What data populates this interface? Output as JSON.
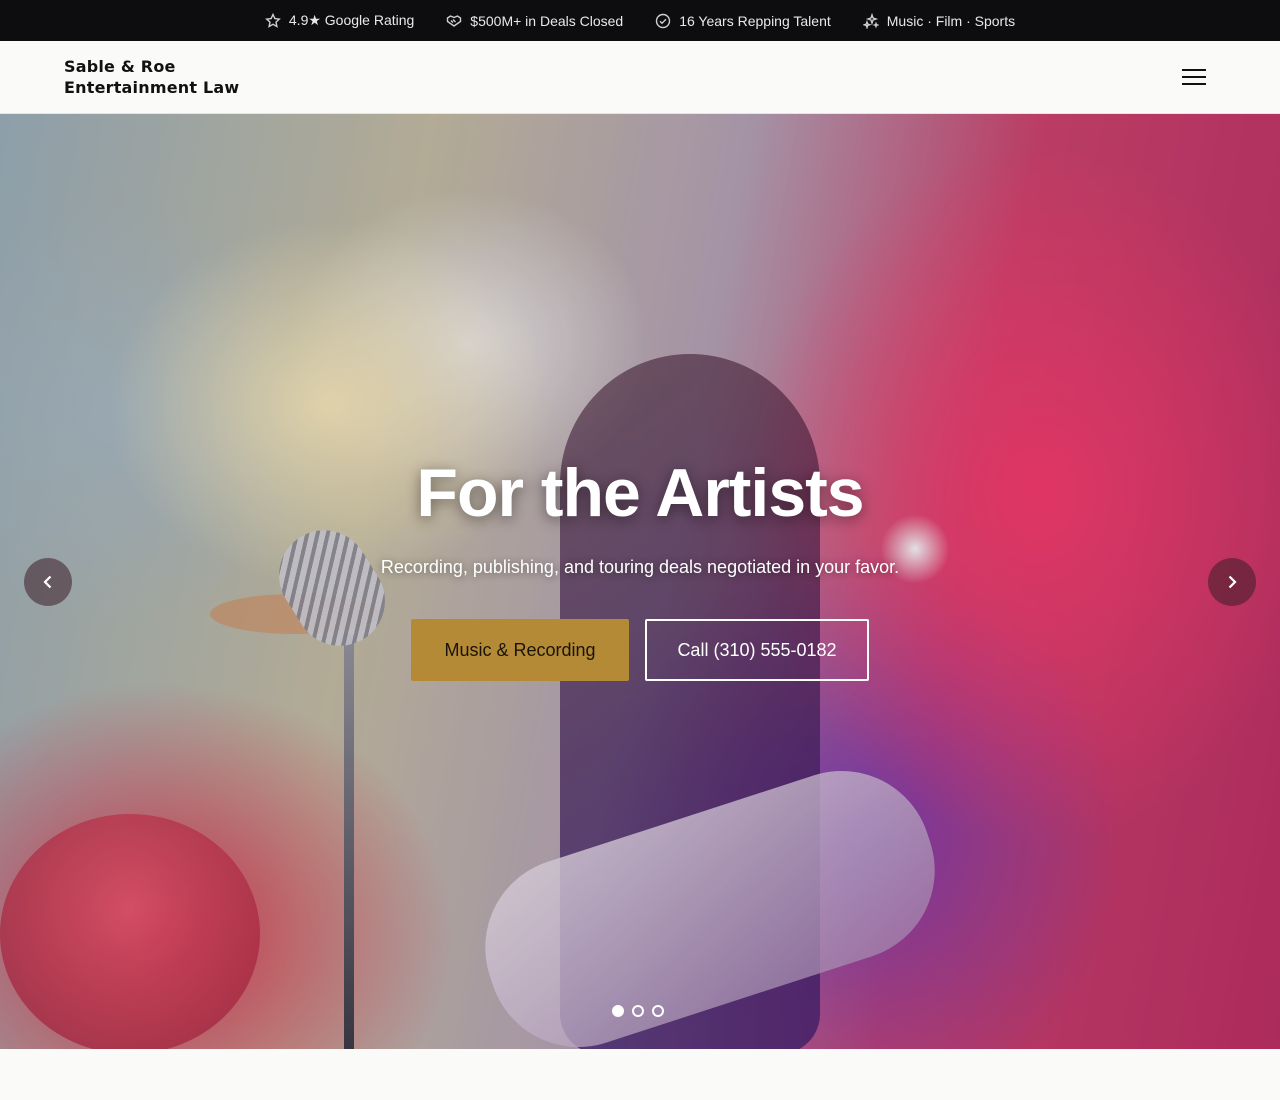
{
  "topbar": {
    "items": [
      {
        "icon": "star-icon",
        "label": "4.9★ Google Rating"
      },
      {
        "icon": "handshake-icon",
        "label": "$500M+ in Deals Closed"
      },
      {
        "icon": "check-circle-icon",
        "label": "16 Years Repping Talent"
      },
      {
        "icon": "sparkles-icon",
        "label": "Music · Film · Sports"
      }
    ]
  },
  "header": {
    "logo_line1": "Sable & Roe",
    "logo_line2": "Entertainment Law",
    "menu_icon": "hamburger-icon"
  },
  "hero": {
    "title": "For the Artists",
    "subtitle": "Recording, publishing, and touring deals negotiated in your favor.",
    "primary_button": "Music & Recording",
    "secondary_button": "Call (310) 555-0182",
    "slide_count": 3,
    "active_slide": 1,
    "colors": {
      "gold": "#b48a36",
      "topbar": "#0d0d10"
    }
  }
}
